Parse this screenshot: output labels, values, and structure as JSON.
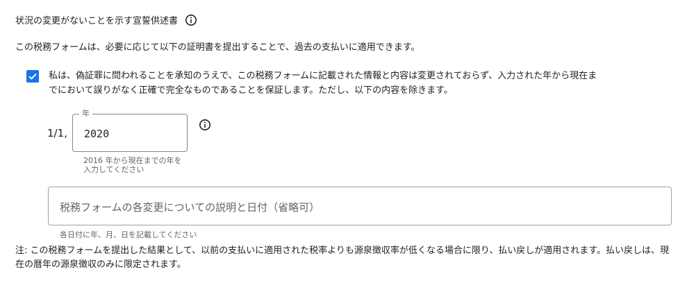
{
  "header": {
    "title": "状況の変更がないことを示す宣誓供述書",
    "info_icon": "info-icon"
  },
  "description": "この税務フォームは、必要に応じて以下の証明書を提出することで、過去の支払いに適用できます。",
  "certification": {
    "checked": true,
    "check_icon": "check-icon",
    "text": "私は、偽証罪に問われることを承知のうえで、この税務フォームに記載された情報と内容は変更されておらず、入力された年から現在までにおいて誤りがなく正確で完全なものであることを保証します。ただし、以下の内容を除きます。"
  },
  "year_field": {
    "prefix": "1/1,",
    "label": "年",
    "value": "2020",
    "hint": "2016 年から現在までの年を入力してください",
    "info_icon": "info-icon"
  },
  "changes_field": {
    "placeholder": "税務フォームの各変更についての説明と日付（省略可）",
    "hint": "各日付に年、月、日を記載してください"
  },
  "note": "注: この税務フォームを提出した結果として、以前の支払いに適用された税率よりも源泉徴収率が低くなる場合に限り、払い戻しが適用されます。払い戻しは、現在の暦年の源泉徴収のみに限定されます。",
  "colors": {
    "accent": "#1a73e8",
    "text": "#202124",
    "secondary_text": "#5f6368",
    "border": "#80868b"
  }
}
